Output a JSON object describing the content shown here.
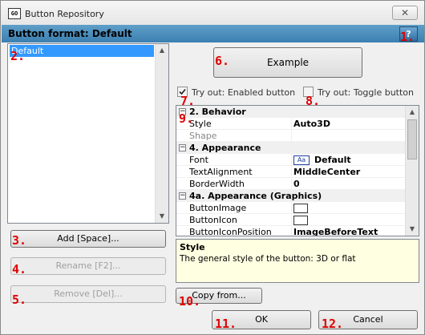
{
  "window": {
    "icon_text": "GO",
    "title": "Button Repository",
    "close_glyph": "✕"
  },
  "header": {
    "title": "Button format: Default",
    "help_label": "?"
  },
  "formats_list": {
    "items": [
      "Default"
    ],
    "selected_index": 0
  },
  "actions": {
    "add_label": "Add [Space]...",
    "rename_label": "Rename [F2]...",
    "remove_label": "Remove [Del]...",
    "copy_from_label": "Copy from...",
    "ok_label": "OK",
    "cancel_label": "Cancel"
  },
  "preview": {
    "example_label": "Example",
    "try_enabled_label": "Try out: Enabled button",
    "try_enabled_checked": true,
    "try_toggle_label": "Try out: Toggle button",
    "try_toggle_checked": false
  },
  "property_grid": {
    "categories": [
      {
        "name": "2. Behavior",
        "props": [
          {
            "name": "Style",
            "value": "Auto3D"
          },
          {
            "name": "Shape",
            "value": ""
          }
        ]
      },
      {
        "name": "4. Appearance",
        "props": [
          {
            "name": "Font",
            "value": "Default",
            "preview": "Aa"
          },
          {
            "name": "TextAlignment",
            "value": "MiddleCenter"
          },
          {
            "name": "BorderWidth",
            "value": "0"
          }
        ]
      },
      {
        "name": "4a. Appearance (Graphics)",
        "props": [
          {
            "name": "ButtonImage",
            "value": ""
          },
          {
            "name": "ButtonIcon",
            "value": ""
          },
          {
            "name": "ButtonIconPosition",
            "value": "ImageBeforeText"
          }
        ]
      }
    ]
  },
  "description": {
    "title": "Style",
    "text": "The general style of the button: 3D or flat"
  },
  "annotations": [
    "1.",
    "2.",
    "3.",
    "4.",
    "5.",
    "6.",
    "7.",
    "8.",
    "9.",
    "10.",
    "11.",
    "12."
  ],
  "colors": {
    "header_bg": "#4a8cbd",
    "selection": "#3399ff",
    "annotation": "#e00000",
    "description_bg": "#ffffe1"
  }
}
